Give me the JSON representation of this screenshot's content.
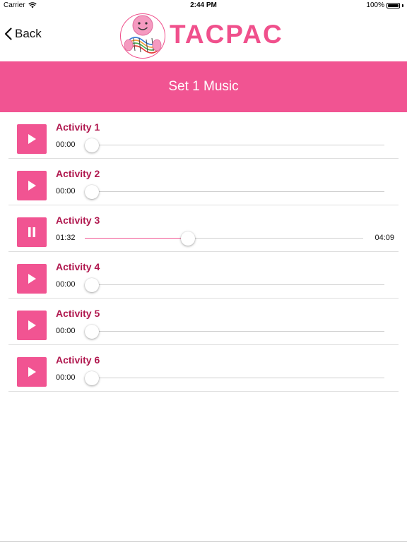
{
  "status_bar": {
    "carrier": "Carrier",
    "time": "2:44 PM",
    "battery": "100%"
  },
  "nav": {
    "back_label": "Back",
    "brand_title": "TACPAC"
  },
  "header": {
    "title": "Set 1 Music"
  },
  "tracks": [
    {
      "title": "Activity 1",
      "current_time": "00:00",
      "total_time": "",
      "state": "stopped",
      "progress": 0
    },
    {
      "title": "Activity 2",
      "current_time": "00:00",
      "total_time": "",
      "state": "stopped",
      "progress": 0
    },
    {
      "title": "Activity 3",
      "current_time": "01:32",
      "total_time": "04:09",
      "state": "playing",
      "progress": 0.37
    },
    {
      "title": "Activity 4",
      "current_time": "00:00",
      "total_time": "",
      "state": "stopped",
      "progress": 0
    },
    {
      "title": "Activity 5",
      "current_time": "00:00",
      "total_time": "",
      "state": "stopped",
      "progress": 0
    },
    {
      "title": "Activity 6",
      "current_time": "00:00",
      "total_time": "",
      "state": "stopped",
      "progress": 0
    }
  ],
  "colors": {
    "accent": "#f15492",
    "title_text": "#b0174e",
    "brand": "#f0508c"
  },
  "icons": {
    "back": "chevron-left-icon",
    "play": "play-icon",
    "pause": "pause-icon",
    "wifi": "wifi-icon",
    "battery": "battery-icon",
    "logo": "tacpac-logo"
  }
}
